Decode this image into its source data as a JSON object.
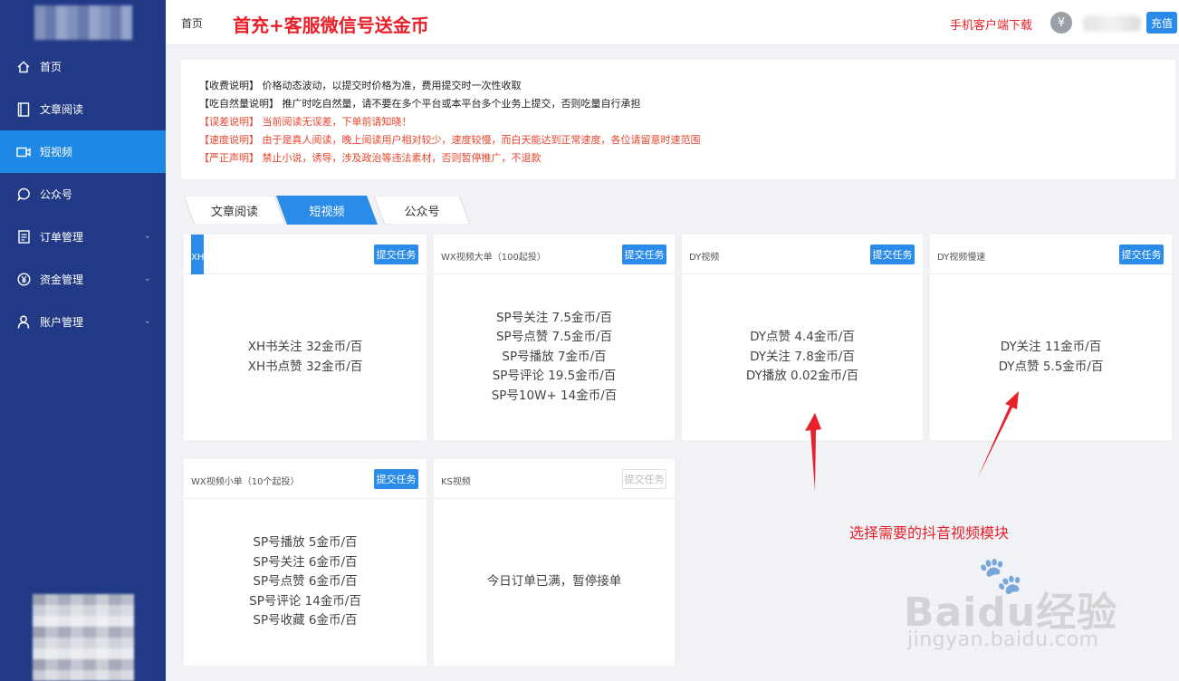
{
  "sidebar": {
    "items": [
      {
        "label": "首页",
        "icon": "home-icon",
        "active": false,
        "has_children": false
      },
      {
        "label": "文章阅读",
        "icon": "book-icon",
        "active": false,
        "has_children": false
      },
      {
        "label": "短视频",
        "icon": "video-icon",
        "active": true,
        "has_children": false
      },
      {
        "label": "公众号",
        "icon": "chat-bubble-icon",
        "active": false,
        "has_children": false
      },
      {
        "label": "订单管理",
        "icon": "document-icon",
        "active": false,
        "has_children": true
      },
      {
        "label": "资金管理",
        "icon": "yuan-icon",
        "active": false,
        "has_children": true
      },
      {
        "label": "账户管理",
        "icon": "user-icon",
        "active": false,
        "has_children": true
      }
    ],
    "chevron": "⌄"
  },
  "header": {
    "home": "首页",
    "promo": "首充+客服微信号送金币",
    "mobile_download": "手机客户端下载",
    "coin_symbol": "¥",
    "recharge": "充值"
  },
  "notice": {
    "lines": [
      {
        "text": "【收费说明】 价格动态波动，以提交时价格为准，费用提交时一次性收取",
        "color": "black"
      },
      {
        "text": "【吃自然量说明】 推广时吃自然量，请不要在多个平台或本平台多个业务上提交，否则吃量自行承担",
        "color": "black"
      },
      {
        "text": "【误差说明】 当前阅读无误差，下单前请知晓！",
        "color": "red"
      },
      {
        "text": "【速度说明】 由于是真人阅读，晚上阅读用户相对较少，速度较慢，而白天能达到正常速度，各位请留意时速范围",
        "color": "red"
      },
      {
        "text": "【严正声明】 禁止小说，诱导，涉及政治等违法素材，否则暂停推广，不退款",
        "color": "red"
      }
    ]
  },
  "tabs": [
    {
      "label": "文章阅读",
      "active": false
    },
    {
      "label": "短视频",
      "active": true
    },
    {
      "label": "公众号",
      "active": false
    }
  ],
  "cards": [
    {
      "title": "XH书",
      "button": "提交任务",
      "enabled": true,
      "lines": [
        "XH书关注 32金币/百",
        "XH书点赞 32金币/百"
      ]
    },
    {
      "title": "WX视频大单（100起投）",
      "button": "提交任务",
      "enabled": true,
      "lines": [
        "SP号关注 7.5金币/百",
        "SP号点赞 7.5金币/百",
        "SP号播放 7金币/百",
        "SP号评论 19.5金币/百",
        "SP号10W+ 14金币/百"
      ]
    },
    {
      "title": "DY视频",
      "button": "提交任务",
      "enabled": true,
      "lines": [
        "DY点赞 4.4金币/百",
        "DY关注 7.8金币/百",
        "DY播放 0.02金币/百"
      ]
    },
    {
      "title": "DY视频慢速",
      "button": "提交任务",
      "enabled": true,
      "lines": [
        "DY关注 11金币/百",
        "DY点赞 5.5金币/百"
      ]
    },
    {
      "title": "WX视频小单（10个起投）",
      "button": "提交任务",
      "enabled": true,
      "lines": [
        "SP号播放 5金币/百",
        "SP号关注 6金币/百",
        "SP号点赞 6金币/百",
        "SP号评论 14金币/百",
        "SP号收藏 6金币/百"
      ]
    },
    {
      "title": "KS视频",
      "button": "提交任务",
      "enabled": false,
      "lines": [
        "今日订单已满，暂停接单"
      ]
    }
  ],
  "annotation": {
    "text": "选择需要的抖音视频模块",
    "color": "#e8202a"
  },
  "watermark": {
    "main": "Baidu经验",
    "sub": "jingyan.baidu.com"
  },
  "colors": {
    "sidebar_bg": "#223a86",
    "active_blue": "#1e88e5",
    "button_blue": "#2b8be8",
    "alert_red": "#e8202a"
  }
}
